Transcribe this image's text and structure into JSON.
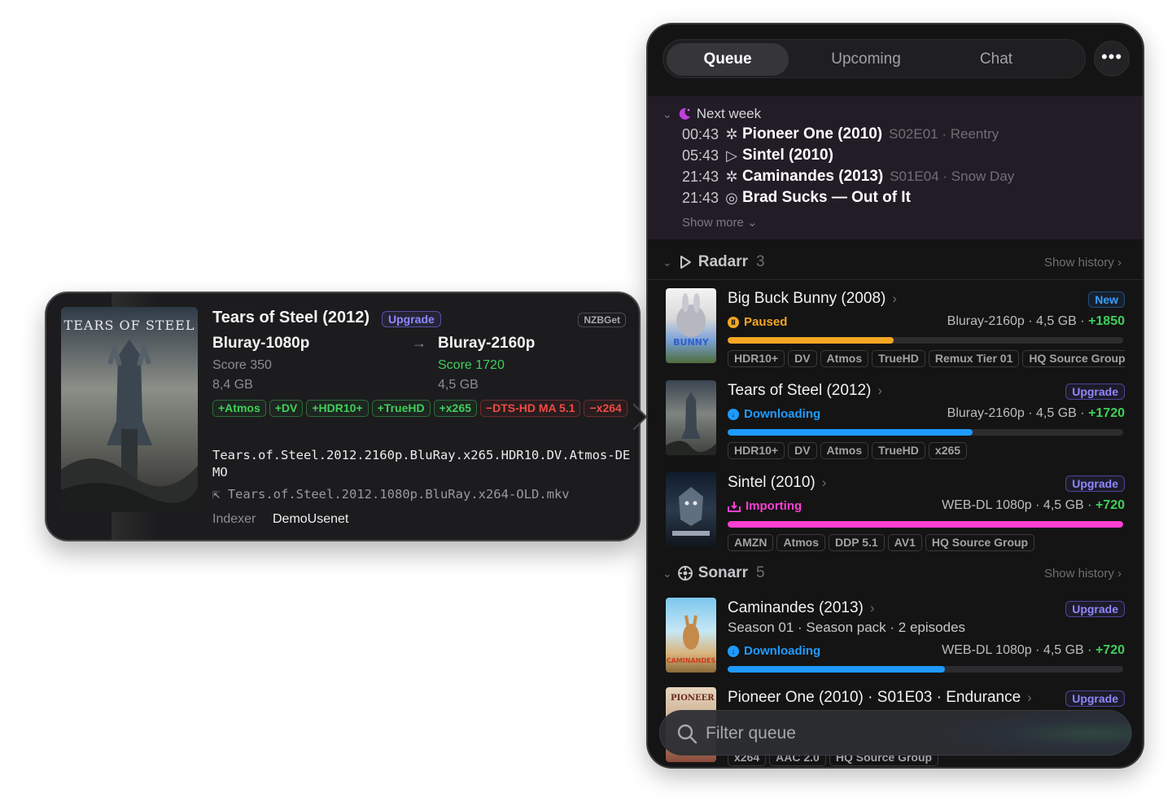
{
  "detail": {
    "title": "Tears of Steel (2012)",
    "badge": "Upgrade",
    "client": "NZBGet",
    "poster_text": "TEARS OF STEEL",
    "from_quality": "Bluray-1080p",
    "to_quality": "Bluray-2160p",
    "arrow": "→",
    "from_score": "Score 350",
    "to_score": "Score 1720",
    "from_size": "8,4 GB",
    "to_size": "4,5 GB",
    "tags": [
      {
        "label": "+Atmos",
        "kind": "add"
      },
      {
        "label": "+DV",
        "kind": "add"
      },
      {
        "label": "+HDR10+",
        "kind": "add"
      },
      {
        "label": "+TrueHD",
        "kind": "add"
      },
      {
        "label": "+x265",
        "kind": "add"
      },
      {
        "label": "−DTS-HD MA 5.1",
        "kind": "rem"
      },
      {
        "label": "−x264",
        "kind": "rem"
      }
    ],
    "release": "Tears.of.Steel.2012.2160p.BluRay.x265.HDR10.DV.Atmos-DEMO",
    "old_file_icon": "⇱",
    "old_file": "Tears.of.Steel.2012.1080p.BluRay.x264-OLD.mkv",
    "indexer_label": "Indexer",
    "indexer": "DemoUsenet"
  },
  "tabs": {
    "queue": "Queue",
    "upcoming": "Upcoming",
    "chat": "Chat",
    "more": "•••",
    "active": "queue"
  },
  "upcoming": {
    "header": "Next week",
    "rows": [
      {
        "time": "00:43",
        "icon": "sonarr-icon",
        "title": "Pioneer One (2010)",
        "sub": "S02E01 · Reentry"
      },
      {
        "time": "05:43",
        "icon": "radarr-icon",
        "title": "Sintel (2010)",
        "sub": ""
      },
      {
        "time": "21:43",
        "icon": "sonarr-icon",
        "title": "Caminandes (2013)",
        "sub": "S01E04 · Snow Day"
      },
      {
        "time": "21:43",
        "icon": "lidarr-icon",
        "title": "Brad Sucks — Out of It",
        "sub": ""
      }
    ],
    "show_more": "Show more"
  },
  "radarr": {
    "name": "Radarr",
    "count": "3",
    "show_history": "Show history",
    "items": [
      {
        "title": "Big Buck Bunny (2008)",
        "badge": "New",
        "status": "Paused",
        "quality": "Bluray-2160p",
        "size": "4,5 GB",
        "score": "+1850",
        "progress": 0.42,
        "color": "#f5a623",
        "tags": [
          "HDR10+",
          "DV",
          "Atmos",
          "TrueHD",
          "Remux Tier 01",
          "HQ Source Group"
        ]
      },
      {
        "title": "Tears of Steel (2012)",
        "badge": "Upgrade",
        "status": "Downloading",
        "quality": "Bluray-2160p",
        "size": "4,5 GB",
        "score": "+1720",
        "progress": 0.62,
        "color": "#1e9bff",
        "tags": [
          "HDR10+",
          "DV",
          "Atmos",
          "TrueHD",
          "x265"
        ]
      },
      {
        "title": "Sintel (2010)",
        "badge": "Upgrade",
        "status": "Importing",
        "quality": "WEB-DL 1080p",
        "size": "4,5 GB",
        "score": "+720",
        "progress": 1.0,
        "color": "#ff3fd2",
        "tags": [
          "AMZN",
          "Atmos",
          "DDP 5.1",
          "AV1",
          "HQ Source Group"
        ]
      }
    ]
  },
  "sonarr": {
    "name": "Sonarr",
    "count": "5",
    "show_history": "Show history",
    "items": [
      {
        "title": "Caminandes (2013)",
        "badge": "Upgrade",
        "season": "Season 01 · Season pack · 2 episodes",
        "status": "Downloading",
        "quality": "WEB-DL 1080p",
        "size": "4,5 GB",
        "score": "+720",
        "progress": 0.55,
        "color": "#1e9bff"
      },
      {
        "title": "Pioneer One (2010) · S01E03 · Endurance",
        "badge": "Upgrade",
        "tags": [
          "x264",
          "AAC 2.0",
          "HQ Source Group"
        ]
      }
    ]
  },
  "filter": {
    "placeholder": "Filter queue"
  },
  "colors": {
    "accent_purple": "#8f87ff",
    "score_green": "#3fcf5a",
    "paused": "#f5a623",
    "downloading": "#1e9bff",
    "importing": "#ff3fd2"
  }
}
